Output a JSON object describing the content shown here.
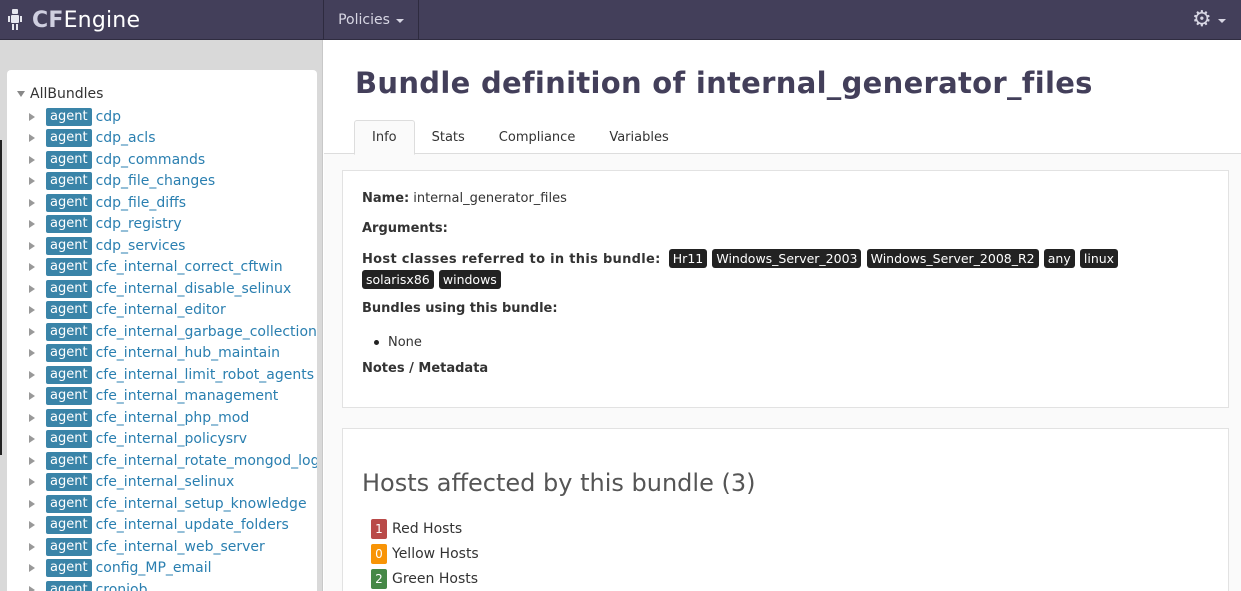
{
  "brand": {
    "bold": "CF",
    "rest": "Engine"
  },
  "nav": {
    "policies": "Policies",
    "settings_icon": "gear-icon"
  },
  "sidebar": {
    "root": "AllBundles",
    "badge": "agent",
    "bundles": [
      "cdp",
      "cdp_acls",
      "cdp_commands",
      "cdp_file_changes",
      "cdp_file_diffs",
      "cdp_registry",
      "cdp_services",
      "cfe_internal_correct_cftwin",
      "cfe_internal_disable_selinux",
      "cfe_internal_editor",
      "cfe_internal_garbage_collection",
      "cfe_internal_hub_maintain",
      "cfe_internal_limit_robot_agents",
      "cfe_internal_management",
      "cfe_internal_php_mod",
      "cfe_internal_policysrv",
      "cfe_internal_rotate_mongod_log",
      "cfe_internal_selinux",
      "cfe_internal_setup_knowledge",
      "cfe_internal_update_folders",
      "cfe_internal_web_server",
      "config_MP_email",
      "cronjob"
    ]
  },
  "page": {
    "title": "Bundle definition of internal_generator_files"
  },
  "tabs": [
    "Info",
    "Stats",
    "Compliance",
    "Variables"
  ],
  "info": {
    "name_label": "Name:",
    "name_value": "internal_generator_files",
    "arguments_label": "Arguments:",
    "classes_label": "Host classes referred to in this bundle:",
    "classes": [
      "Hr11",
      "Windows_Server_2003",
      "Windows_Server_2008_R2",
      "any",
      "linux",
      "solarisx86",
      "windows"
    ],
    "using_label": "Bundles using this bundle:",
    "using_value": "None",
    "notes_label": "Notes / Metadata"
  },
  "hosts": {
    "title": "Hosts affected by this bundle (3)",
    "rows": [
      {
        "count": "1",
        "label": "Red Hosts",
        "color": "#b94a48"
      },
      {
        "count": "0",
        "label": "Yellow Hosts",
        "color": "#f89406"
      },
      {
        "count": "2",
        "label": "Green Hosts",
        "color": "#468847"
      }
    ]
  }
}
